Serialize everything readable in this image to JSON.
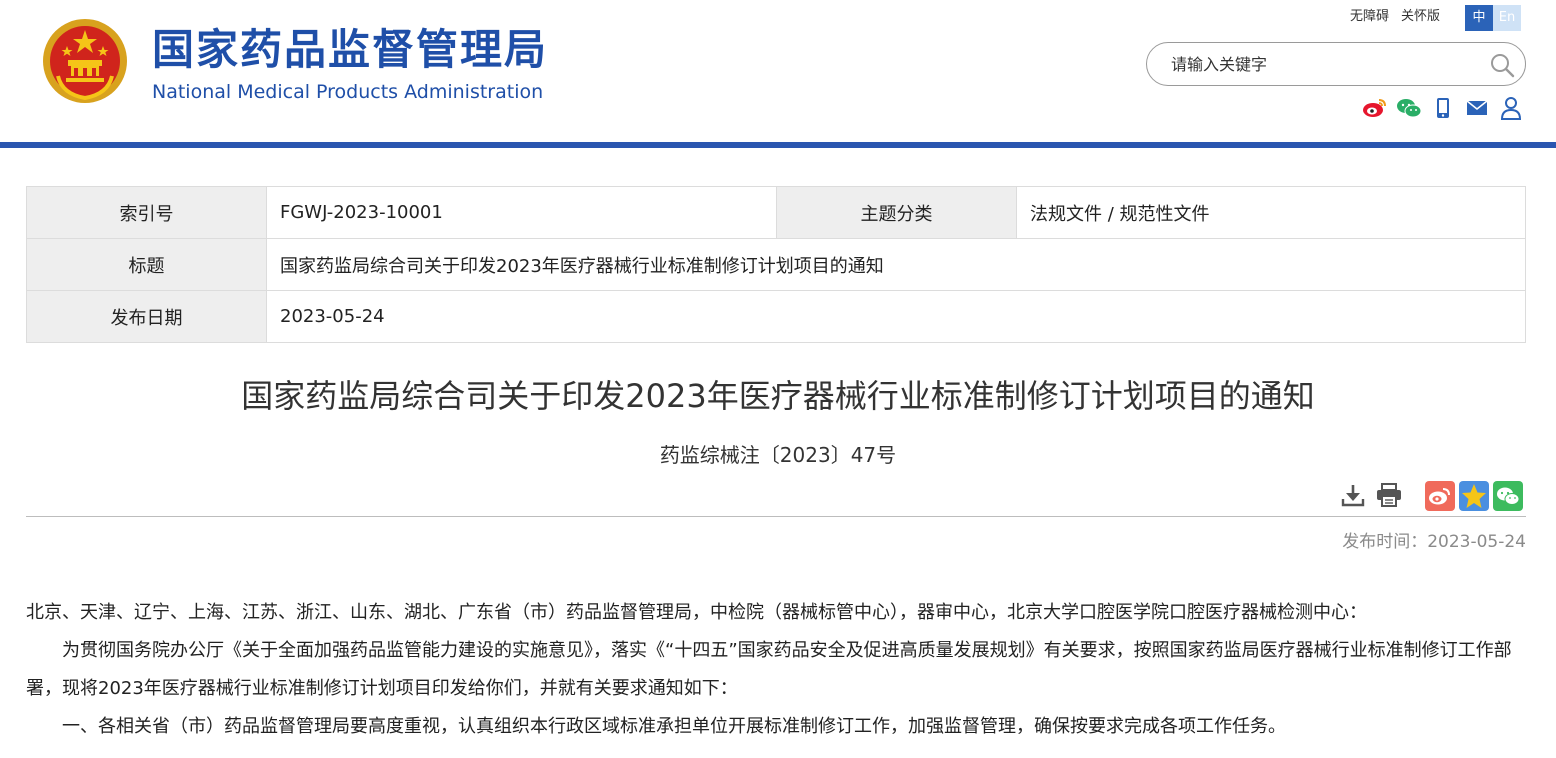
{
  "header": {
    "title_cn": "国家药品监督管理局",
    "title_en": "National Medical Products Administration",
    "links": [
      "无障碍",
      "关怀版"
    ],
    "lang_zh": "中",
    "lang_en": "En",
    "search_placeholder": "请输入关键字",
    "social_icons": [
      "weibo-icon",
      "wechat-icon",
      "mobile-icon",
      "mail-icon",
      "user-icon"
    ],
    "brand_color": "#1f4fa8",
    "rule_color": "#2a56b0"
  },
  "info": {
    "index_label": "索引号",
    "index_value": "FGWJ-2023-10001",
    "category_label": "主题分类",
    "category_value": "法规文件 / 规范性文件",
    "title_label": "标题",
    "title_value": "国家药监局综合司关于印发2023年医疗器械行业标准制修订计划项目的通知",
    "date_label": "发布日期",
    "date_value": "2023-05-24"
  },
  "doc": {
    "title": "国家药监局综合司关于印发2023年医疗器械行业标准制修订计划项目的通知",
    "number": "药监综械注〔2023〕47号",
    "publish_time": "发布时间：2023-05-24",
    "tool_icons": [
      "download-icon",
      "print-icon"
    ],
    "share_icons": [
      "weibo-share-icon",
      "qzone-share-icon",
      "wechat-share-icon"
    ],
    "paragraphs": [
      "北京、天津、辽宁、上海、江苏、浙江、山东、湖北、广东省（市）药品监督管理局，中检院（器械标管中心），器审中心，北京大学口腔医学院口腔医疗器械检测中心：",
      "为贯彻国务院办公厅《关于全面加强药品监管能力建设的实施意见》，落实《“十四五”国家药品安全及促进高质量发展规划》有关要求，按照国家药监局医疗器械行业标准制修订工作部署，现将2023年医疗器械行业标准制修订计划项目印发给你们，并就有关要求通知如下：",
      "一、各相关省（市）药品监督管理局要高度重视，认真组织本行政区域标准承担单位开展标准制修订工作，加强监督管理，确保按要求完成各项工作任务。"
    ]
  }
}
